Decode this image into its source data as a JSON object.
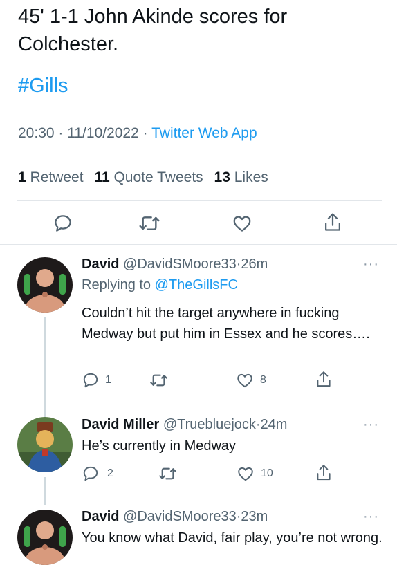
{
  "main_tweet": {
    "text": "45' 1-1 John Akinde scores for Colchester.",
    "hashtag": "#Gills",
    "time": "20:30",
    "date": "11/10/2022",
    "source": "Twitter Web App",
    "sep": "·",
    "stats": {
      "retweets_count": "1",
      "retweets_label": "Retweet",
      "quotes_count": "11",
      "quotes_label": "Quote Tweets",
      "likes_count": "13",
      "likes_label": "Likes"
    }
  },
  "replies": [
    {
      "name": "David",
      "handle": "@DavidSMoore33",
      "age": "26m",
      "replying_prefix": "Replying to",
      "replying_to": "@TheGillsFC",
      "text": "Couldn’t hit the target anywhere in fucking Medway but put him in Essex and he scores….",
      "reply_count": "1",
      "like_count": "8",
      "more": "···"
    },
    {
      "name": "David Miller",
      "handle": "@Truebluejock",
      "age": "24m",
      "text": "He’s currently in Medway",
      "reply_count": "2",
      "like_count": "10",
      "more": "···"
    },
    {
      "name": "David",
      "handle": "@DavidSMoore33",
      "age": "23m",
      "text": "You know what David, fair play, you’re not wrong.",
      "more": "···"
    }
  ],
  "icons": {
    "reply": "reply-icon",
    "retweet": "retweet-icon",
    "like": "heart-icon",
    "share": "share-icon",
    "more": "more-icon"
  },
  "colors": {
    "link": "#1d9bf0",
    "text": "#0f1419",
    "secondary": "#536471",
    "divider": "#e2e6ea"
  }
}
